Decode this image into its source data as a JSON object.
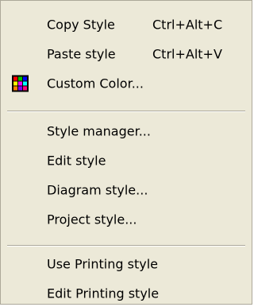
{
  "menu": {
    "items": [
      {
        "label": "Copy Style",
        "shortcut": "Ctrl+Alt+C"
      },
      {
        "label": "Paste style",
        "shortcut": "Ctrl+Alt+V"
      },
      {
        "label": "Custom Color...",
        "icon": "color-palette-icon"
      },
      {
        "label": "Style manager..."
      },
      {
        "label": "Edit style"
      },
      {
        "label": "Diagram style..."
      },
      {
        "label": "Project style..."
      },
      {
        "label": "Use Printing style"
      },
      {
        "label": "Edit Printing style"
      }
    ]
  },
  "colors": {
    "menu_background": "#ece9d8",
    "separator": "#aca899",
    "text": "#000000"
  }
}
